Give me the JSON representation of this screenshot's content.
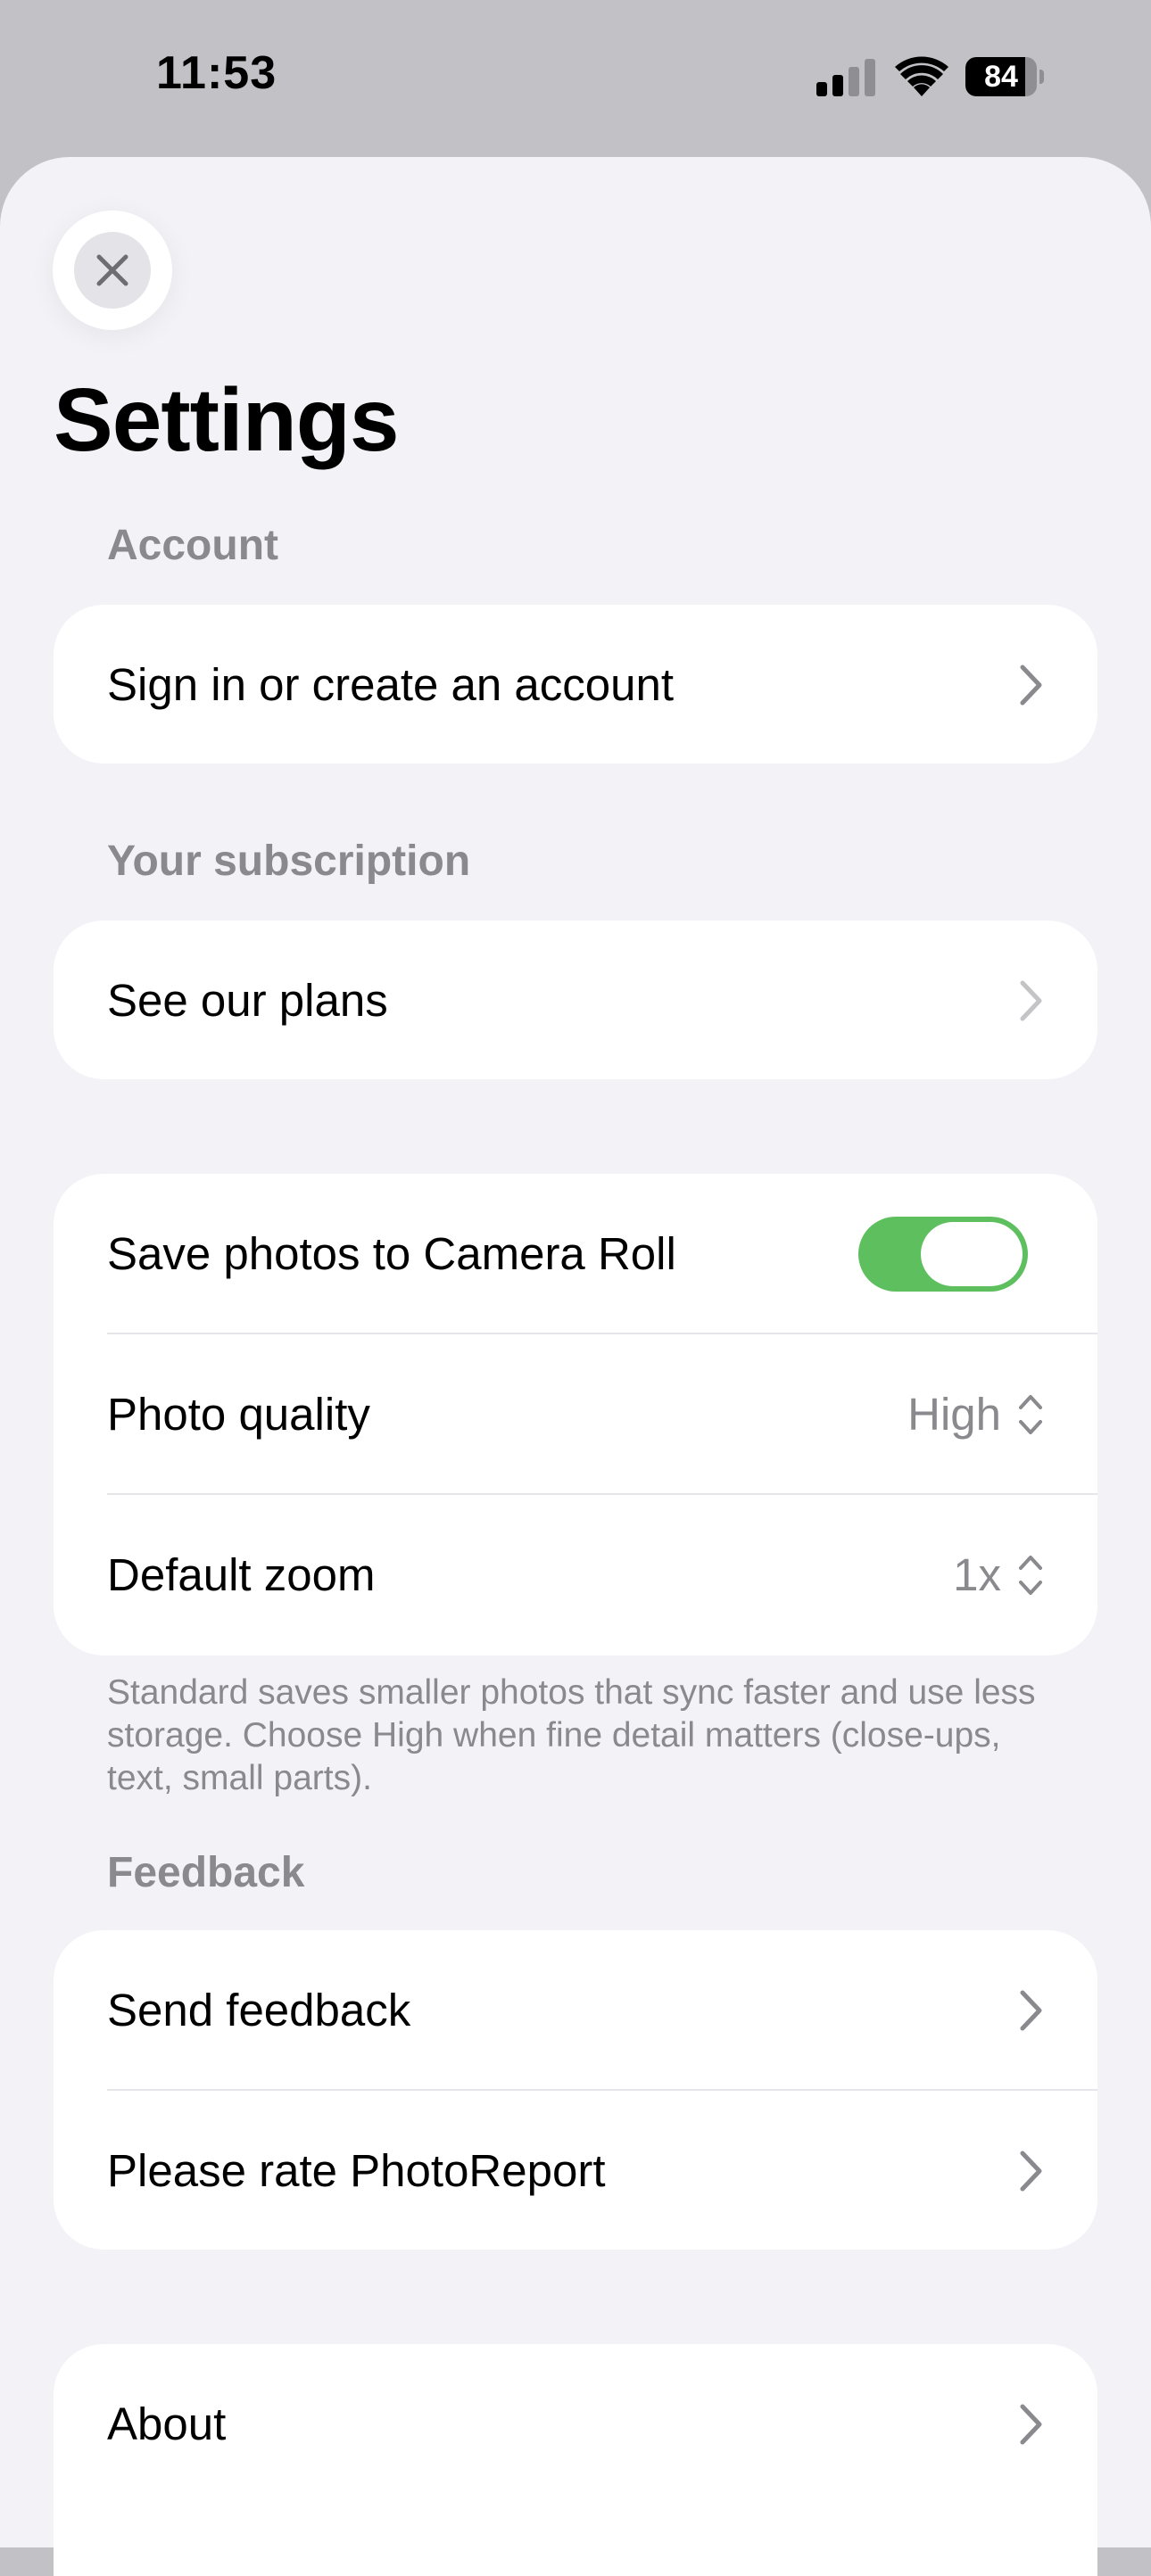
{
  "status_bar": {
    "time": "11:53",
    "battery": "84",
    "battery_level": 0.84
  },
  "header": {
    "close_icon": "xmark-icon",
    "title": "Settings"
  },
  "sections": {
    "account": {
      "header": "Account",
      "sign_in_label": "Sign in or create an account"
    },
    "subscription": {
      "header": "Your subscription",
      "plans_label": "See our plans"
    },
    "photo_settings": {
      "save_to_camera_roll_label": "Save photos to Camera Roll",
      "save_to_camera_roll_enabled": true,
      "photo_quality_label": "Photo quality",
      "photo_quality_value": "High",
      "default_zoom_label": "Default zoom",
      "default_zoom_value": "1x",
      "footnote": "Standard saves smaller photos that sync faster and use less storage. Choose High when fine detail matters (close-ups, text, small parts)."
    },
    "feedback": {
      "header": "Feedback",
      "send_feedback_label": "Send feedback",
      "rate_label": "Please rate PhotoReport"
    },
    "about": {
      "about_label": "About"
    }
  },
  "colors": {
    "toggle_on": "#5ebf5e",
    "secondary_text": "#8a8a8e",
    "sheet_background": "#f2f2f7"
  }
}
